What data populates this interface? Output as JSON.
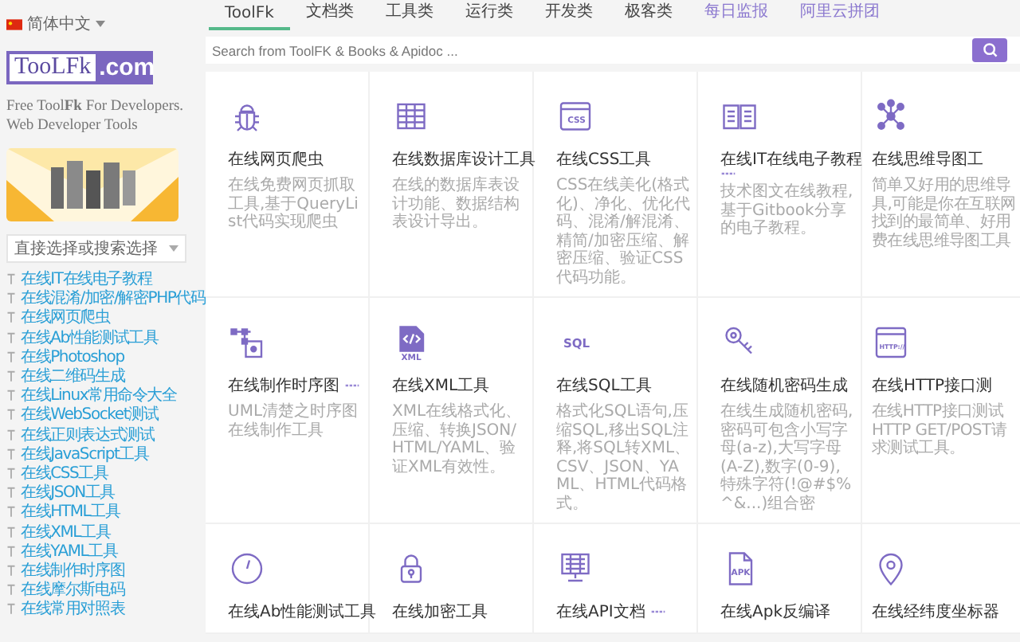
{
  "sidebar": {
    "language": "简体中文",
    "logo": {
      "left": "TooLFk",
      "right": ".com"
    },
    "tagline": "Free Tool**Fk** For Developers. Web Developer Tools",
    "select": {
      "placeholder": "直接选择或搜索选择"
    },
    "links": [
      "在线IT在线电子教程",
      "在线混淆/加密/解密PHP代码",
      "在线网页爬虫",
      "在线Ab性能测试工具",
      "在线Photoshop",
      "在线二维码生成",
      "在线Linux常用命令大全",
      "在线WebSocket测试",
      "在线正则表达式测试",
      "在线JavaScript工具",
      "在线CSS工具",
      "在线JSON工具",
      "在线HTML工具",
      "在线XML工具",
      "在线YAML工具",
      "在线制作时序图",
      "在线摩尔斯电码",
      "在线常用对照表"
    ]
  },
  "tabs": [
    {
      "label": "ToolFk",
      "kind": "category",
      "selected": true
    },
    {
      "label": "文档类",
      "kind": "category",
      "selected": false
    },
    {
      "label": "工具类",
      "kind": "category",
      "selected": false
    },
    {
      "label": "运行类",
      "kind": "category",
      "selected": false
    },
    {
      "label": "开发类",
      "kind": "category",
      "selected": false
    },
    {
      "label": "极客类",
      "kind": "category",
      "selected": false
    },
    {
      "label": "每日监报",
      "kind": "link",
      "selected": false
    },
    {
      "label": "阿里云拼团",
      "kind": "link",
      "selected": false
    }
  ],
  "search": {
    "placeholder": "Search from ToolFK & Books & Apidoc ..."
  },
  "cards": [
    {
      "title": "在线网页爬虫",
      "new_mark": false,
      "desc": "在线免费网页抓取工具,基于QueryList代码实现爬虫"
    },
    {
      "title": "在线数据库设计工具",
      "new_mark": false,
      "desc": "在线的数据库表设计功能、数据结构表设计导出。"
    },
    {
      "title": "在线CSS工具",
      "new_mark": false,
      "icon_label": "CSS",
      "desc": "CSS在线美化(格式化)、净化、优化代码、混淆/解混淆、精简/加密压缩、解密压缩、验证CSS代码功能。"
    },
    {
      "title": "在线IT在线电子教程",
      "new_mark": true,
      "desc": "技术图文在线教程,基于Gitbook分享的电子教程。"
    },
    {
      "title": "在线思维导图工",
      "new_mark": false,
      "desc_lines": [
        "简单又好用的思维导",
        "具,可能是你在互联网",
        "找到的最简单、好用",
        "费在线思维导图工具"
      ]
    },
    {
      "title": "在线制作时序图",
      "new_mark": true,
      "desc": "UML清楚之时序图在线制作工具"
    },
    {
      "title": "在线XML工具",
      "new_mark": false,
      "icon_label": "XML",
      "desc": "XML在线格式化、压缩、转换JSON/HTML/YAML、验证XML有效性。"
    },
    {
      "title": "在线SQL工具",
      "new_mark": false,
      "icon_label": "SQL",
      "desc": "格式化SQL语句,压缩SQL,移出SQL注释,将SQL转XML、CSV、JSON、YAML、HTML代码格式。"
    },
    {
      "title": "在线随机密码生成",
      "new_mark": false,
      "desc": "在线生成随机密码,密码可包含小写字母(a-z),大写字母(A-Z),数字(0-9),特殊字符(!@#$%^&...)组合密"
    },
    {
      "title": "在线HTTP接口测",
      "new_mark": false,
      "icon_label": "HTTP://",
      "desc_lines": [
        "在线HTTP接口测试",
        "HTTP GET/POST请",
        "求测试工具。"
      ]
    },
    {
      "title": "在线Ab性能测试工具",
      "new_mark": false
    },
    {
      "title": "在线加密工具",
      "new_mark": false
    },
    {
      "title": "在线API文档",
      "new_mark": true
    },
    {
      "title": "在线Apk反编译",
      "new_mark": false,
      "icon_label": "APK"
    },
    {
      "title": "在线经纬度坐标器",
      "new_mark": false
    }
  ]
}
